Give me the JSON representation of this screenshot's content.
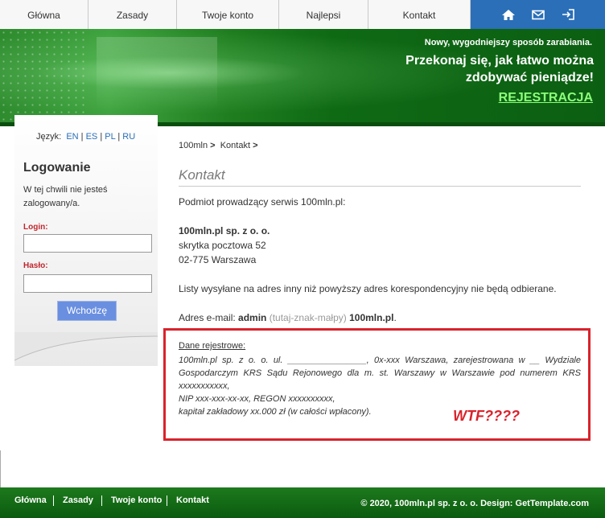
{
  "nav": {
    "tabs": [
      "Główna",
      "Zasady",
      "Twoje konto",
      "Najlepsi",
      "Kontakt"
    ],
    "icons": [
      "home-icon",
      "mail-icon",
      "login-icon"
    ]
  },
  "banner": {
    "tagline": "Nowy, wygodniejszy sposób zarabiania.",
    "headline_line1": "Przekonaj się, jak łatwo można",
    "headline_line2": "zdobywać pieniądze!",
    "register_link": "REJESTRACJA"
  },
  "sidebar": {
    "lang_label": "Język:",
    "languages": [
      "EN",
      "ES",
      "PL",
      "RU"
    ],
    "login_title": "Logowanie",
    "status_line1": "W tej chwili nie jesteś",
    "status_line2": "zalogowany/a.",
    "login_label": "Login:",
    "login_value": "",
    "password_label": "Hasło:",
    "password_value": "",
    "submit_label": "Wchodzę"
  },
  "breadcrumb": {
    "items": [
      "100mln",
      "Kontakt"
    ],
    "separator": ">"
  },
  "content": {
    "title": "Kontakt",
    "intro": "Podmiot prowadzący serwis 100mln.pl:",
    "company_name": "100mln.pl sp. z o. o.",
    "address_line1": "skrytka pocztowa 52",
    "address_line2": "02-775 Warszawa",
    "notice": "Listy wysyłane na adres inny niż powyższy adres korespondencyjny nie będą odbierane.",
    "email_prefix": "Adres e-mail:",
    "email_user": "admin",
    "email_at": "(tutaj-znak-małpy)",
    "email_domain": "100mln.pl",
    "email_suffix": ".",
    "registry_label": "Dane rejestrowe:",
    "registry_line1": "100mln.pl sp. z o. o. ul. ________________, 0x-xxx Warszawa, zarejestrowana w __ Wydziale Gospodarczym KRS Sądu Rejonowego dla m. st. Warszawy w Warszawie pod numerem KRS xxxxxxxxxxx,",
    "registry_line2": "NIP xxx-xxx-xx-xx, REGON xxxxxxxxxx,",
    "registry_line3": "kapitał zakładowy xx.000 zł (w całości wpłacony).",
    "annotation": "WTF????"
  },
  "footer": {
    "links": [
      "Główna",
      "Zasady",
      "Twoje konto",
      "Kontakt"
    ],
    "copyright": "© 2020, 100mln.pl sp. z o. o. Design: GetTemplate.com"
  },
  "colors": {
    "accent_green": "#0b5f12",
    "nav_blue": "#2a6fb8",
    "highlight_red": "#d9232c",
    "register_green": "#8cff7a"
  }
}
